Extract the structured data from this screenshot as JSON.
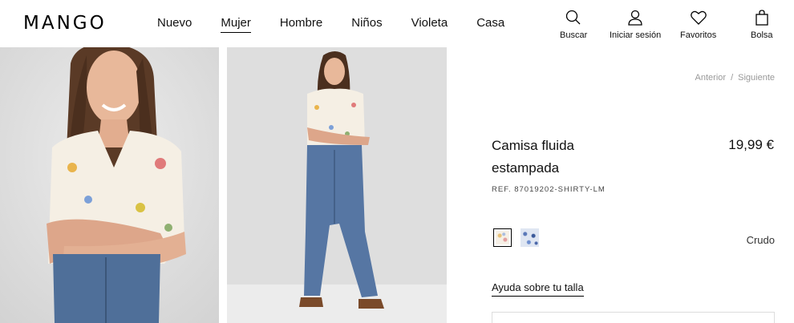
{
  "header": {
    "logo": "MANGO",
    "nav": [
      {
        "label": "Nuevo"
      },
      {
        "label": "Mujer",
        "active": true
      },
      {
        "label": "Hombre"
      },
      {
        "label": "Niños"
      },
      {
        "label": "Violeta"
      },
      {
        "label": "Casa"
      }
    ],
    "utilities": {
      "search": {
        "label": "Buscar",
        "icon": "search-icon"
      },
      "login": {
        "label": "Iniciar sesión",
        "icon": "user-icon"
      },
      "favorites": {
        "label": "Favoritos",
        "icon": "heart-icon"
      },
      "bag": {
        "label": "Bolsa",
        "icon": "bag-icon"
      }
    }
  },
  "pager": {
    "previous": "Anterior",
    "separator": "/",
    "next": "Siguiente"
  },
  "product": {
    "title": "Camisa fluida estampada",
    "price": "19,99 €",
    "ref": "REF. 87019202-SHIRTY-LM",
    "color_selected": "Crudo",
    "size_help": "Ayuda sobre tu talla"
  },
  "colors": {
    "background": "#ffffff",
    "text": "#000000",
    "muted": "#999999",
    "border": "#dddddd"
  }
}
